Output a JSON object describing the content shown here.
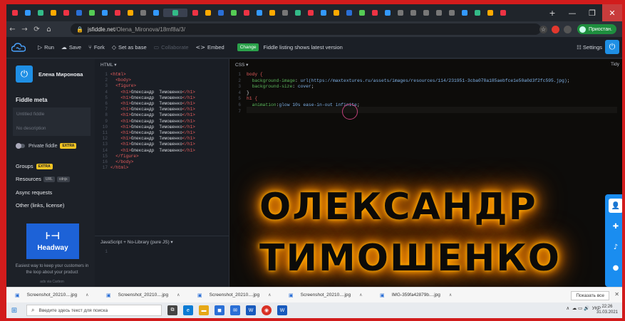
{
  "browser": {
    "url_host": "jsfiddle.net",
    "url_path": "/Olena_Mironova/18mf8a/3/",
    "tab_count": 40,
    "window_minimize": "—",
    "window_restore": "❐",
    "window_close": "✕",
    "new_tab": "+",
    "profile_label": "Приостан."
  },
  "toolbar": {
    "run": "Run",
    "save": "Save",
    "fork": "Fork",
    "set_as_base": "Set as base",
    "collaborate": "Collaborate",
    "embed": "Embed",
    "changelog_badge": "Change",
    "notice": "Fiddle listing shows latest version",
    "settings": "Settings"
  },
  "sidebar": {
    "user_name": "Елена Миронова",
    "fiddle_meta": "Fiddle meta",
    "title_placeholder": "Untitled fiddle",
    "description_placeholder": "No description",
    "private_fiddle": "Private fiddle",
    "pro_badge": "EXTRA",
    "groups": "Groups",
    "groups_badge": "EXTRA",
    "resources": "Resources",
    "resources_badge1": "URL",
    "resources_badge2": "cdnjs",
    "async_requests": "Async requests",
    "other": "Other (links, license)",
    "ad_brand": "Headway",
    "ad_text": "Easiest way to keep your customers in the loop about your product",
    "ad_credit": "ads via Carbon"
  },
  "html_pane": {
    "label": "HTML ▾",
    "lines": [
      {
        "n": "1",
        "code": "<html>"
      },
      {
        "n": "2",
        "code": "  <body>"
      },
      {
        "n": "3",
        "code": "  <figure>"
      },
      {
        "n": "4",
        "code": "    <h1>Олександр  Тимошенко</h1>"
      },
      {
        "n": "5",
        "code": "    <h1>Олександр  Тимошенко</h1>"
      },
      {
        "n": "6",
        "code": "    <h1>Олександр  Тимошенко</h1>"
      },
      {
        "n": "7",
        "code": "    <h1>Олександр  Тимошенко</h1>"
      },
      {
        "n": "8",
        "code": "    <h1>Олександр  Тимошенко</h1>"
      },
      {
        "n": "9",
        "code": "    <h1>Олександр  Тимошенко</h1>"
      },
      {
        "n": "10",
        "code": "    <h1>Олександр  Тимошенко</h1>"
      },
      {
        "n": "11",
        "code": "    <h1>Олександр  Тимошенко</h1>"
      },
      {
        "n": "12",
        "code": "    <h1>Олександр  Тимошенко</h1>"
      },
      {
        "n": "13",
        "code": "    <h1>Олександр  Тимошенко</h1>"
      },
      {
        "n": "14",
        "code": "    <h1>Олександр  Тимошенко</h1>"
      },
      {
        "n": "15",
        "code": "  </figure>"
      },
      {
        "n": "16",
        "code": "  </body>"
      },
      {
        "n": "17",
        "code": "</html>"
      }
    ]
  },
  "js_pane": {
    "label": "JavaScript + No-Library (pure JS) ▾",
    "line1": "1"
  },
  "css_pane": {
    "label": "CSS ▾",
    "tidy": "Tidy",
    "lines": [
      {
        "n": "1",
        "code": "body {"
      },
      {
        "n": "2",
        "code": "  background-image: url(https://maxtextures.ru/assets/images/resources/114/231951-3cba078a185aebfce1e50a0d3f2fc595.jpg);"
      },
      {
        "n": "3",
        "code": "  background-size: cover;"
      },
      {
        "n": "4",
        "code": "}"
      },
      {
        "n": "5",
        "code": "h1 {"
      },
      {
        "n": "6",
        "code": "  animation:glow 10s ease-in-out infinite;"
      },
      {
        "n": "7",
        "code": ""
      }
    ]
  },
  "result": {
    "line1": "ОЛЕКСАНДР",
    "line2": "ТИМОШЕНКО"
  },
  "downloads": {
    "items": [
      "Screenshot_20210....jpg",
      "Screenshot_20210....jpg",
      "Screenshot_20210....jpg",
      "Screenshot_20210....jpg",
      "IMG-359fa42879b....jpg"
    ],
    "show_all": "Показать все"
  },
  "taskbar": {
    "search_placeholder": "Введите здесь текст для поиска",
    "language": "УКР",
    "time": "22:26",
    "date": "31.03.2021"
  },
  "colors": {
    "accent_blue": "#1f8fe5",
    "glow_orange": "#ff9a00",
    "tag_red": "#e85d5d",
    "border_red": "#d21c1c"
  }
}
